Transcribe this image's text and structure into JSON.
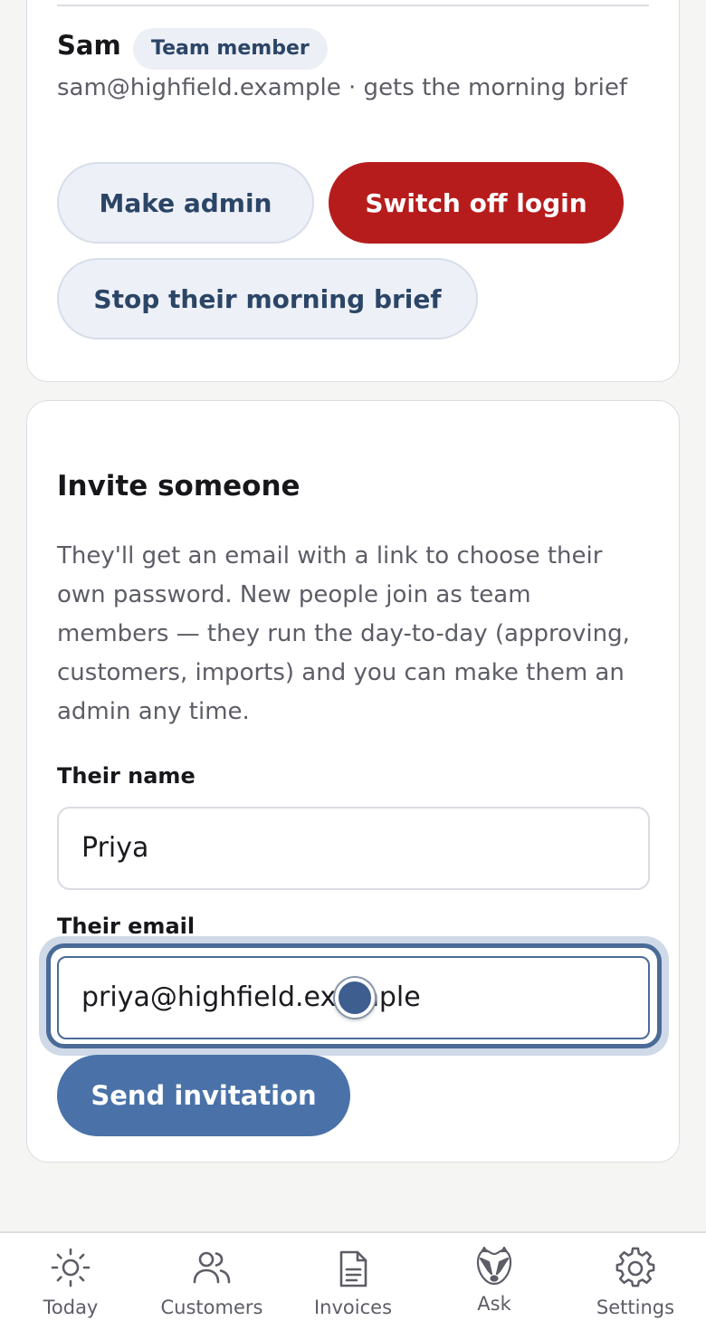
{
  "member": {
    "name": "Sam",
    "role_badge": "Team member",
    "email_line": "sam@highfield.example · gets the morning brief",
    "make_admin_label": "Make admin",
    "switch_off_login_label": "Switch off login",
    "stop_brief_label": "Stop their morning brief"
  },
  "invite": {
    "title": "Invite someone",
    "description": "They'll get an email with a link to choose their own password. New people join as team members — they run the day-to-day (approving, customers, imports) and you can make them an admin any time.",
    "name_label": "Their name",
    "name_value": "Priya",
    "email_label": "Their email",
    "email_value": "priya@highfield.example",
    "send_label": "Send invitation"
  },
  "nav": {
    "items": [
      {
        "label": "Today",
        "icon": "sun-icon"
      },
      {
        "label": "Customers",
        "icon": "users-icon"
      },
      {
        "label": "Invoices",
        "icon": "document-icon"
      },
      {
        "label": "Ask",
        "icon": "badger-icon"
      },
      {
        "label": "Settings",
        "icon": "gear-icon"
      }
    ]
  },
  "colors": {
    "danger": "#b71c1c",
    "primary": "#4a72a8",
    "focus": "#4a6b97"
  }
}
